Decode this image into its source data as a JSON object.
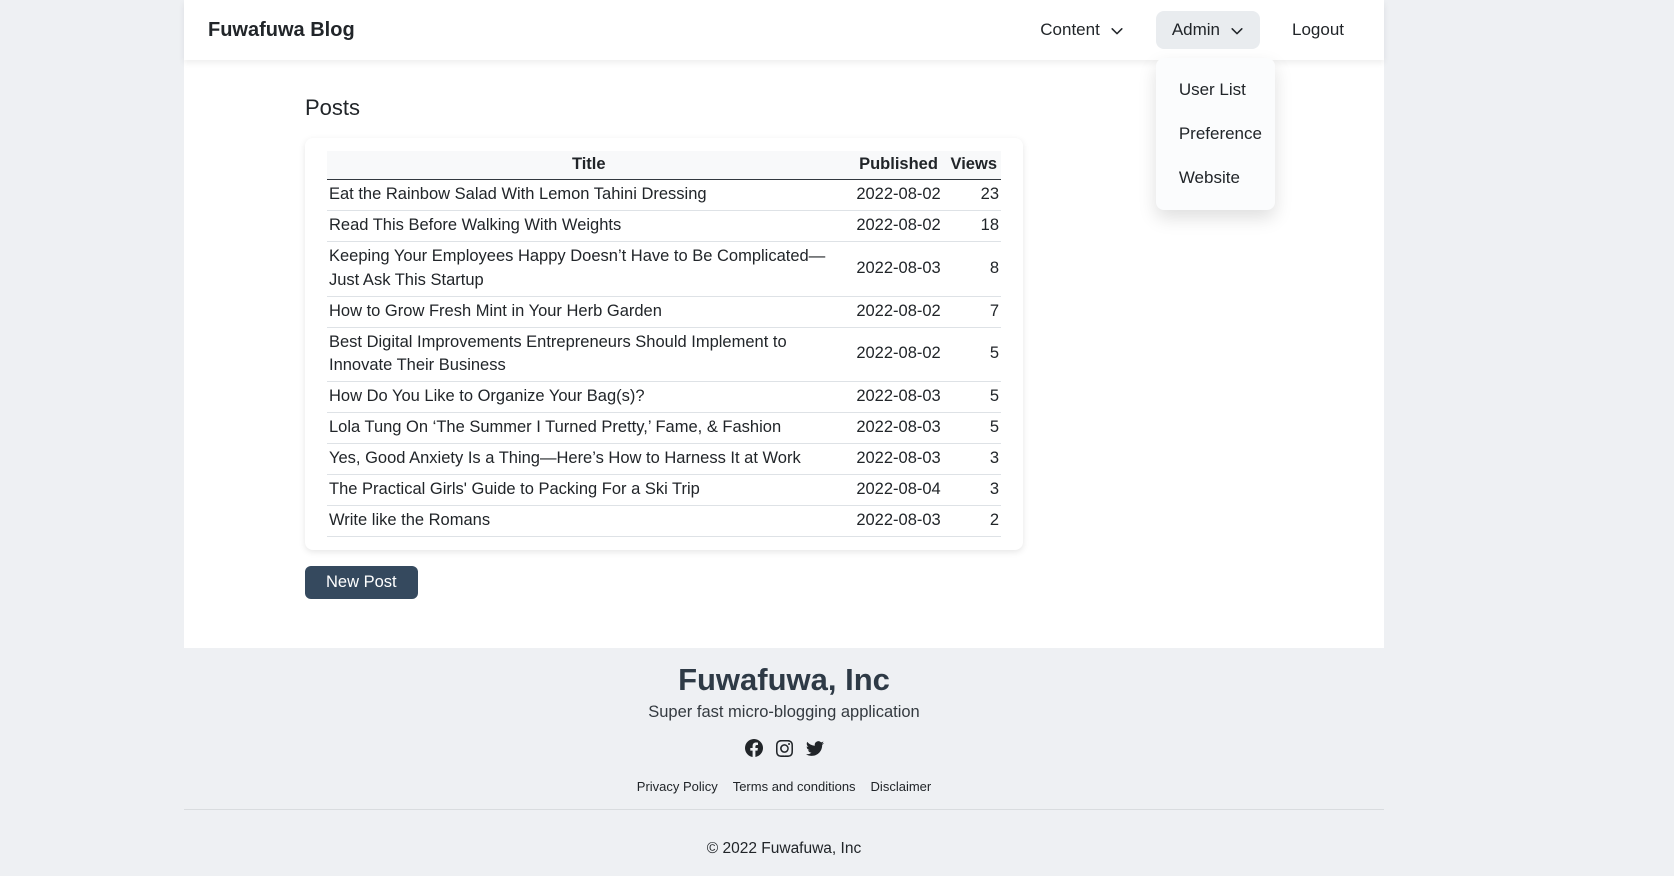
{
  "navbar": {
    "brand": "Fuwafuwa Blog",
    "content_label": "Content",
    "admin_label": "Admin",
    "logout_label": "Logout"
  },
  "admin_dropdown": {
    "items": [
      "User List",
      "Preference",
      "Website"
    ]
  },
  "main": {
    "heading": "Posts",
    "table": {
      "columns": [
        "Title",
        "Published",
        "Views"
      ],
      "rows": [
        {
          "title": "Eat the Rainbow Salad With Lemon Tahini Dressing",
          "published": "2022-08-02",
          "views": "23"
        },
        {
          "title": "Read This Before Walking With Weights",
          "published": "2022-08-02",
          "views": "18"
        },
        {
          "title": "Keeping Your Employees Happy Doesn’t Have to Be Complicated—Just Ask This Startup",
          "published": "2022-08-03",
          "views": "8"
        },
        {
          "title": "How to Grow Fresh Mint in Your Herb Garden",
          "published": "2022-08-02",
          "views": "7"
        },
        {
          "title": "Best Digital Improvements Entrepreneurs Should Implement to Innovate Their Business",
          "published": "2022-08-02",
          "views": "5"
        },
        {
          "title": "How Do You Like to Organize Your Bag(s)?",
          "published": "2022-08-03",
          "views": "5"
        },
        {
          "title": "Lola Tung On ‘The Summer I Turned Pretty,’ Fame, & Fashion",
          "published": "2022-08-03",
          "views": "5"
        },
        {
          "title": "Yes, Good Anxiety Is a Thing—Here’s How to Harness It at Work",
          "published": "2022-08-03",
          "views": "3"
        },
        {
          "title": "The Practical Girls' Guide to Packing For a Ski Trip",
          "published": "2022-08-04",
          "views": "3"
        },
        {
          "title": "Write like the Romans",
          "published": "2022-08-03",
          "views": "2"
        }
      ]
    },
    "new_post_label": "New Post"
  },
  "footer": {
    "company": "Fuwafuwa, Inc",
    "tagline": "Super fast micro-blogging application",
    "social_icons": [
      "facebook-icon",
      "instagram-icon",
      "twitter-icon"
    ],
    "links": [
      "Privacy Policy",
      "Terms and conditions",
      "Disclaimer"
    ],
    "copyright": "© 2022 Fuwafuwa, Inc"
  },
  "colors": {
    "button_dark": "#35495e",
    "nav_active_bg": "#e9ecef",
    "text_dark": "#212529",
    "page_bg": "#eef0f3"
  }
}
